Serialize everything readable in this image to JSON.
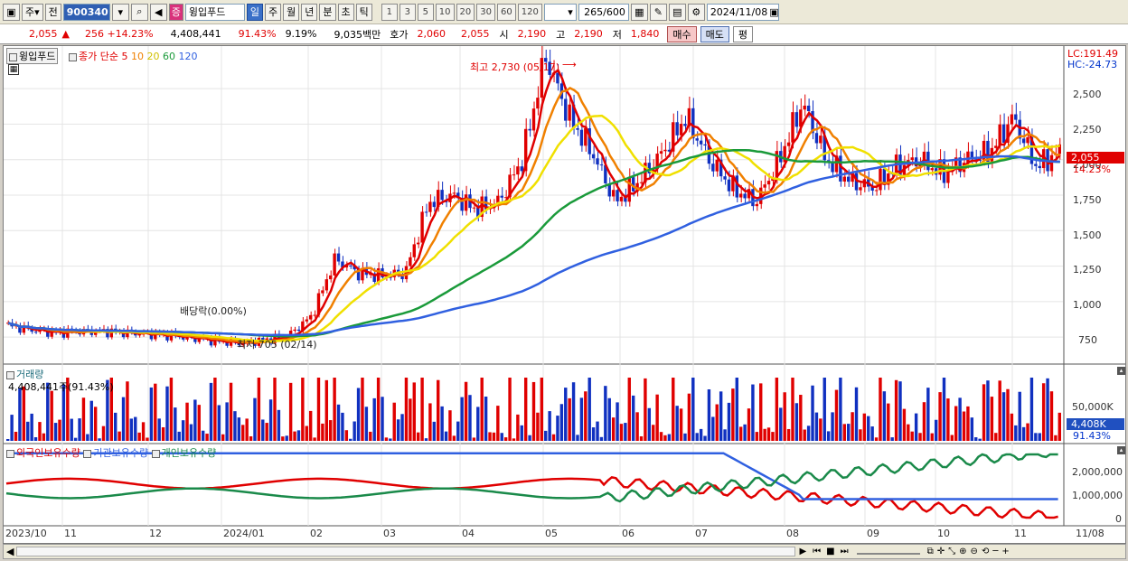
{
  "toolbar": {
    "period_type": "주",
    "prev_label": "전",
    "stock_code": "900340",
    "stock_badge": "증",
    "stock_name": "윙입푸드",
    "period_tabs": [
      "일",
      "주",
      "월",
      "년",
      "분",
      "초",
      "틱"
    ],
    "active_tab": "일",
    "minute_options": [
      "1",
      "3",
      "5",
      "10",
      "20",
      "30",
      "60",
      "120"
    ],
    "count": "265",
    "count_max": "/600",
    "date": "2024/11/08"
  },
  "quote": {
    "price": "2,055",
    "change_arrow": "▲",
    "change": "256 +14.23%",
    "volume": "4,408,441",
    "volume_ratio": "91.43%",
    "turnover": "9.19%",
    "amount": "9,035백만",
    "ask_label": "호가",
    "ask": "2,060",
    "bid": "2,055",
    "open_label": "시",
    "open": "2,190",
    "high_label": "고",
    "high": "2,190",
    "low_label": "저",
    "low": "1,840",
    "buy_button": "매수",
    "sell_button": "매도",
    "avg_button": "평"
  },
  "price_panel": {
    "stock_name": "윙입푸드",
    "ma_label": "종가 단순",
    "ma_periods": [
      "5",
      "10",
      "20",
      "60",
      "120"
    ],
    "ma_colors": [
      "#e00000",
      "#f08000",
      "#f0e000",
      "#1a9a3a",
      "#3060e0"
    ],
    "lc": "LC:191.49",
    "hc": "HC:-24.73",
    "high_annot": "최고 2,730 (05/17)",
    "low_annot": "최저 705 (02/14)",
    "dividend_annot": "배당락(0.00%)",
    "y_ticks": [
      "2,500",
      "2,250",
      "2,000",
      "1,750",
      "1,500",
      "1,250",
      "1,000",
      "750"
    ],
    "y_values": [
      2500,
      2250,
      2000,
      1750,
      1500,
      1250,
      1000,
      750
    ],
    "price_box": "2,055",
    "price_pct": "14.23%",
    "y_range": [
      560,
      2800
    ]
  },
  "volume_panel": {
    "title": "거래량",
    "value": "4,408,441주(91.43%)",
    "y_tick": "50,000K",
    "box": "4,408K",
    "pct": "91.43%"
  },
  "holding_panel": {
    "series": [
      "외국인보유수량",
      "기관보유수량",
      "개인보유수량"
    ],
    "colors": [
      "#e00000",
      "#3060e0",
      "#1a8a4a"
    ],
    "y_ticks": [
      "2,000,000",
      "1,000,000",
      "0"
    ]
  },
  "x_axis": [
    "2023/10",
    "11",
    "12",
    "2024/01",
    "02",
    "03",
    "04",
    "05",
    "06",
    "07",
    "08",
    "09",
    "10",
    "11",
    "11/08"
  ],
  "chart_data": {
    "type": "line",
    "title": "",
    "series": [
      {
        "name": "종가",
        "values": [
          830,
          800,
          780,
          790,
          790,
          780,
          770,
          760,
          740,
          720,
          705,
          730,
          760,
          900,
          1300,
          1200,
          1180,
          1200,
          1700,
          1750,
          1650,
          1700,
          2000,
          2730,
          2300,
          2050,
          1700,
          1850,
          2050,
          2300,
          2000,
          1800,
          1700,
          2000,
          2400,
          2000,
          1850,
          1800,
          1950,
          2000,
          1900,
          2000,
          2050,
          2300,
          1950,
          2055
        ]
      }
    ]
  }
}
